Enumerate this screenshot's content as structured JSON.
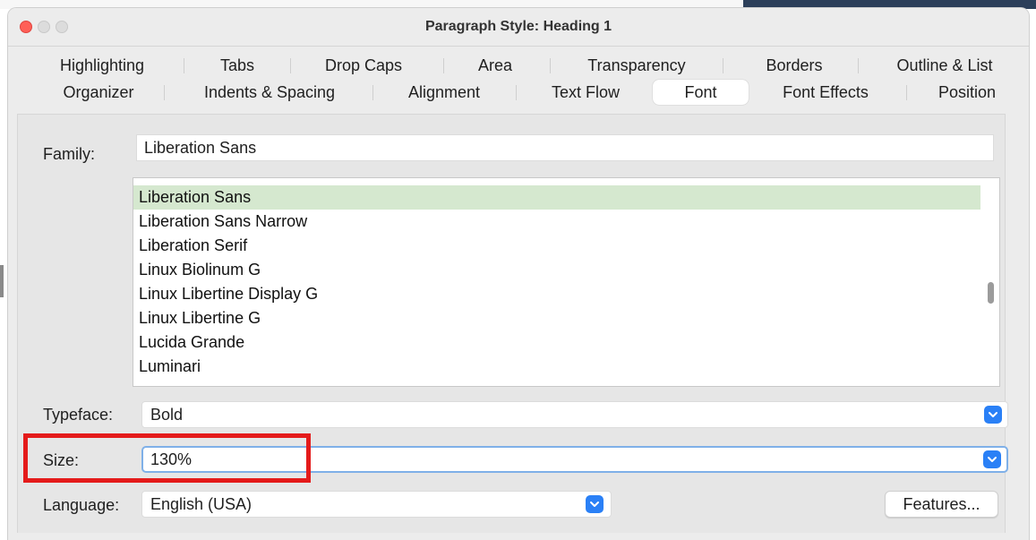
{
  "window": {
    "title": "Paragraph Style: Heading 1"
  },
  "tabs": {
    "row1": [
      "Highlighting",
      "Tabs",
      "Drop Caps",
      "Area",
      "Transparency",
      "Borders",
      "Outline & List"
    ],
    "row2": [
      "Organizer",
      "Indents & Spacing",
      "Alignment",
      "Text Flow",
      "Font",
      "Font Effects",
      "Position"
    ],
    "active": "Font"
  },
  "font": {
    "family_label": "Family:",
    "family_value": "Liberation Sans",
    "family_list": [
      "Liberation Sans",
      "Liberation Sans Narrow",
      "Liberation Serif",
      "Linux Biolinum G",
      "Linux Libertine Display G",
      "Linux Libertine G",
      "Lucida Grande",
      "Luminari"
    ],
    "selected_family": "Liberation Sans",
    "typeface_label": "Typeface:",
    "typeface_value": "Bold",
    "size_label": "Size:",
    "size_value": "130%",
    "language_label": "Language:",
    "language_value": "English (USA)",
    "features_label": "Features..."
  },
  "colors": {
    "selection": "#d5e8cf",
    "accent": "#2a80f6",
    "annotation": "#e41b1b"
  },
  "icons": {
    "dropdown": "chevron-down-icon",
    "window_controls": [
      "close-icon",
      "minimize-icon",
      "zoom-icon"
    ]
  }
}
